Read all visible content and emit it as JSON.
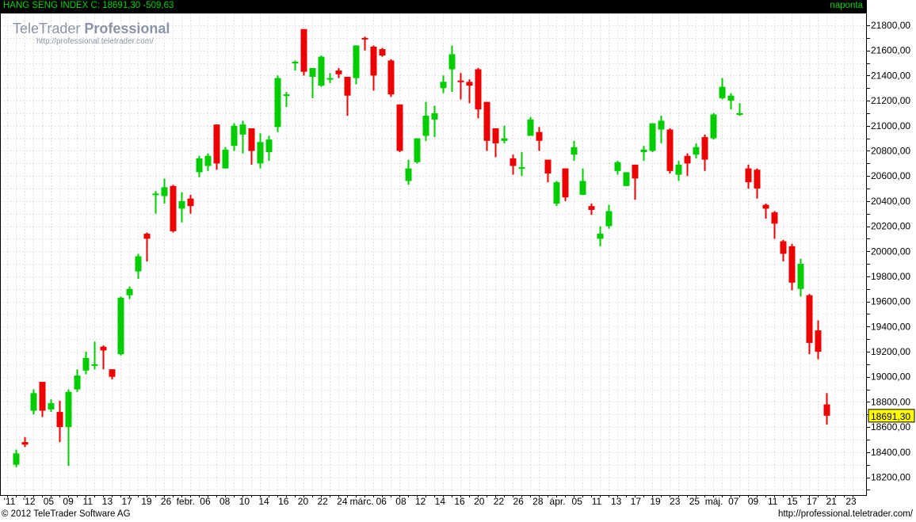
{
  "header": {
    "title": "HANG SENG INDEX C: 18691,30 -509,63",
    "period": "naponta"
  },
  "logo": {
    "name_prefix": "TeleTrader ",
    "name_bold": "Professional",
    "url": "http://professional.teletrader.com/"
  },
  "footer": {
    "copyright": "© 2012 TeleTrader Software AG",
    "url": "http://professional.teletrader.com/"
  },
  "colors": {
    "up": "#00cc00",
    "down": "#ee0000",
    "grid": "#c8c8c8",
    "last_price_bg": "#ffff00"
  },
  "chart_data": {
    "type": "candlestick",
    "title": "HANG SENG INDEX",
    "last_price_label": "18691,30",
    "ylim": [
      18000,
      22000
    ],
    "y_ticks": [
      18200,
      18400,
      18600,
      18800,
      19000,
      19200,
      19400,
      19600,
      19800,
      20000,
      20200,
      20400,
      20600,
      20800,
      21000,
      21200,
      21400,
      21600,
      21800
    ],
    "y_tick_labels": [
      "18200,00",
      "18400,00",
      "18600,00",
      "18800,00",
      "19000,00",
      "19200,00",
      "19400,00",
      "19600,00",
      "19800,00",
      "20000,00",
      "20200,00",
      "20400,00",
      "20600,00",
      "20800,00",
      "21000,00",
      "21200,00",
      "21400,00",
      "21600,00",
      "21800,00"
    ],
    "x_labels": [
      "'11",
      "'12",
      "05",
      "09",
      "11",
      "13",
      "17",
      "19",
      "26",
      "febr.",
      "06",
      "08",
      "10",
      "14",
      "16",
      "20",
      "22",
      "24",
      "márc.",
      "06",
      "08",
      "12",
      "14",
      "16",
      "20",
      "22",
      "26",
      "28",
      "ápr.",
      "05",
      "11",
      "13",
      "17",
      "19",
      "23",
      "25",
      "máj.",
      "07",
      "09",
      "11",
      "15",
      "17",
      "21",
      "23"
    ],
    "candles": [
      {
        "o": 18300,
        "h": 18420,
        "l": 18280,
        "c": 18390
      },
      {
        "o": 18480,
        "h": 18520,
        "l": 18440,
        "c": 18460
      },
      {
        "o": 18730,
        "h": 18900,
        "l": 18700,
        "c": 18870
      },
      {
        "o": 18960,
        "h": 18960,
        "l": 18680,
        "c": 18730
      },
      {
        "o": 18740,
        "h": 18820,
        "l": 18720,
        "c": 18790
      },
      {
        "o": 18720,
        "h": 18810,
        "l": 18480,
        "c": 18600
      },
      {
        "o": 18600,
        "h": 18900,
        "l": 18290,
        "c": 18880
      },
      {
        "o": 18900,
        "h": 19060,
        "l": 18880,
        "c": 19010
      },
      {
        "o": 19050,
        "h": 19200,
        "l": 19020,
        "c": 19150
      },
      {
        "o": 19100,
        "h": 19280,
        "l": 19060,
        "c": 19100
      },
      {
        "o": 19240,
        "h": 19250,
        "l": 19060,
        "c": 19210
      },
      {
        "o": 19060,
        "h": 19060,
        "l": 18980,
        "c": 19000
      },
      {
        "o": 19180,
        "h": 19640,
        "l": 19170,
        "c": 19630
      },
      {
        "o": 19650,
        "h": 19720,
        "l": 19620,
        "c": 19700
      },
      {
        "o": 19840,
        "h": 19980,
        "l": 19780,
        "c": 19960
      },
      {
        "o": 20140,
        "h": 20150,
        "l": 19920,
        "c": 20100
      },
      {
        "o": 20460,
        "h": 20480,
        "l": 20300,
        "c": 20460
      },
      {
        "o": 20440,
        "h": 20580,
        "l": 20380,
        "c": 20510
      },
      {
        "o": 20520,
        "h": 20530,
        "l": 20150,
        "c": 20160
      },
      {
        "o": 20340,
        "h": 20470,
        "l": 20230,
        "c": 20400
      },
      {
        "o": 20420,
        "h": 20450,
        "l": 20300,
        "c": 20360
      },
      {
        "o": 20630,
        "h": 20760,
        "l": 20590,
        "c": 20740
      },
      {
        "o": 20680,
        "h": 20780,
        "l": 20640,
        "c": 20760
      },
      {
        "o": 21010,
        "h": 21010,
        "l": 20650,
        "c": 20700
      },
      {
        "o": 20660,
        "h": 20830,
        "l": 20660,
        "c": 20810
      },
      {
        "o": 20840,
        "h": 21020,
        "l": 20800,
        "c": 21000
      },
      {
        "o": 20930,
        "h": 21040,
        "l": 20780,
        "c": 21010
      },
      {
        "o": 20980,
        "h": 20980,
        "l": 20690,
        "c": 20800
      },
      {
        "o": 20700,
        "h": 20940,
        "l": 20660,
        "c": 20870
      },
      {
        "o": 20790,
        "h": 20920,
        "l": 20720,
        "c": 20890
      },
      {
        "o": 20990,
        "h": 21400,
        "l": 20950,
        "c": 21380
      },
      {
        "o": 21250,
        "h": 21270,
        "l": 21150,
        "c": 21250
      },
      {
        "o": 21510,
        "h": 21520,
        "l": 21440,
        "c": 21510
      },
      {
        "o": 21770,
        "h": 21770,
        "l": 21400,
        "c": 21430
      },
      {
        "o": 21390,
        "h": 21460,
        "l": 21220,
        "c": 21460
      },
      {
        "o": 21320,
        "h": 21560,
        "l": 21310,
        "c": 21550
      },
      {
        "o": 21380,
        "h": 21420,
        "l": 21340,
        "c": 21380
      },
      {
        "o": 21440,
        "h": 21460,
        "l": 21380,
        "c": 21410
      },
      {
        "o": 21390,
        "h": 21390,
        "l": 21080,
        "c": 21240
      },
      {
        "o": 21380,
        "h": 21640,
        "l": 21330,
        "c": 21640
      },
      {
        "o": 21700,
        "h": 21710,
        "l": 21600,
        "c": 21690
      },
      {
        "o": 21630,
        "h": 21640,
        "l": 21280,
        "c": 21400
      },
      {
        "o": 21610,
        "h": 21620,
        "l": 21550,
        "c": 21560
      },
      {
        "o": 21520,
        "h": 21530,
        "l": 21230,
        "c": 21250
      },
      {
        "o": 21170,
        "h": 21170,
        "l": 20790,
        "c": 20800
      },
      {
        "o": 20560,
        "h": 20730,
        "l": 20530,
        "c": 20660
      },
      {
        "o": 20710,
        "h": 20900,
        "l": 20700,
        "c": 20900
      },
      {
        "o": 20920,
        "h": 21190,
        "l": 20880,
        "c": 21080
      },
      {
        "o": 21050,
        "h": 21160,
        "l": 20910,
        "c": 21100
      },
      {
        "o": 21300,
        "h": 21400,
        "l": 21260,
        "c": 21350
      },
      {
        "o": 21450,
        "h": 21640,
        "l": 21270,
        "c": 21570
      },
      {
        "o": 21360,
        "h": 21420,
        "l": 21210,
        "c": 21350
      },
      {
        "o": 21350,
        "h": 21370,
        "l": 21180,
        "c": 21320
      },
      {
        "o": 21450,
        "h": 21460,
        "l": 21060,
        "c": 21130
      },
      {
        "o": 21190,
        "h": 21190,
        "l": 20800,
        "c": 20880
      },
      {
        "o": 20980,
        "h": 20980,
        "l": 20750,
        "c": 20860
      },
      {
        "o": 20880,
        "h": 21000,
        "l": 20860,
        "c": 20900
      },
      {
        "o": 20740,
        "h": 20770,
        "l": 20610,
        "c": 20680
      },
      {
        "o": 20660,
        "h": 20790,
        "l": 20600,
        "c": 20670
      },
      {
        "o": 20920,
        "h": 21070,
        "l": 20920,
        "c": 21050
      },
      {
        "o": 20950,
        "h": 20990,
        "l": 20800,
        "c": 20880
      },
      {
        "o": 20730,
        "h": 20730,
        "l": 20550,
        "c": 20620
      },
      {
        "o": 20380,
        "h": 20560,
        "l": 20360,
        "c": 20550
      },
      {
        "o": 20660,
        "h": 20660,
        "l": 20400,
        "c": 20430
      },
      {
        "o": 20770,
        "h": 20880,
        "l": 20720,
        "c": 20830
      },
      {
        "o": 20450,
        "h": 20660,
        "l": 20450,
        "c": 20560
      },
      {
        "o": 20360,
        "h": 20380,
        "l": 20290,
        "c": 20330
      },
      {
        "o": 20100,
        "h": 20200,
        "l": 20040,
        "c": 20140
      },
      {
        "o": 20200,
        "h": 20370,
        "l": 20180,
        "c": 20320
      },
      {
        "o": 20640,
        "h": 20720,
        "l": 20610,
        "c": 20710
      },
      {
        "o": 20520,
        "h": 20620,
        "l": 20520,
        "c": 20630
      },
      {
        "o": 20690,
        "h": 20690,
        "l": 20410,
        "c": 20580
      },
      {
        "o": 20790,
        "h": 20840,
        "l": 20720,
        "c": 20810
      },
      {
        "o": 20800,
        "h": 21000,
        "l": 20790,
        "c": 21020
      },
      {
        "o": 20970,
        "h": 21080,
        "l": 20860,
        "c": 21040
      },
      {
        "o": 20970,
        "h": 20980,
        "l": 20620,
        "c": 20640
      },
      {
        "o": 20610,
        "h": 20720,
        "l": 20560,
        "c": 20690
      },
      {
        "o": 20760,
        "h": 20780,
        "l": 20600,
        "c": 20700
      },
      {
        "o": 20770,
        "h": 20860,
        "l": 20740,
        "c": 20830
      },
      {
        "o": 20910,
        "h": 20930,
        "l": 20640,
        "c": 20730
      },
      {
        "o": 20900,
        "h": 21100,
        "l": 20890,
        "c": 21090
      },
      {
        "o": 21220,
        "h": 21380,
        "l": 21210,
        "c": 21310
      },
      {
        "o": 21200,
        "h": 21260,
        "l": 21130,
        "c": 21240
      },
      {
        "o": 21100,
        "h": 21180,
        "l": 21080,
        "c": 21100
      },
      {
        "o": 20660,
        "h": 20690,
        "l": 20500,
        "c": 20550
      },
      {
        "o": 20650,
        "h": 20660,
        "l": 20420,
        "c": 20500
      },
      {
        "o": 20370,
        "h": 20380,
        "l": 20260,
        "c": 20340
      },
      {
        "o": 20310,
        "h": 20320,
        "l": 20100,
        "c": 20220
      },
      {
        "o": 20080,
        "h": 20090,
        "l": 19920,
        "c": 19980
      },
      {
        "o": 20040,
        "h": 20060,
        "l": 19690,
        "c": 19750
      },
      {
        "o": 19700,
        "h": 19940,
        "l": 19640,
        "c": 19900
      },
      {
        "o": 19650,
        "h": 19660,
        "l": 19180,
        "c": 19270
      },
      {
        "o": 19370,
        "h": 19450,
        "l": 19140,
        "c": 19200
      },
      {
        "o": 18780,
        "h": 18870,
        "l": 18620,
        "c": 18690
      }
    ]
  }
}
